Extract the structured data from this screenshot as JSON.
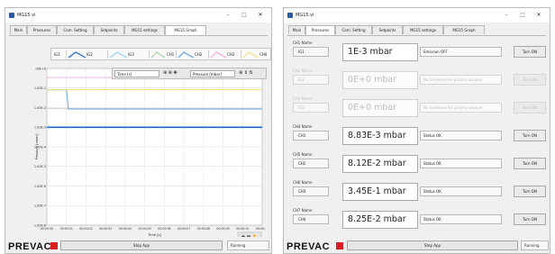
{
  "left_window": {
    "title": "MG15.vi",
    "controls": {
      "minimize": "–",
      "maximize": "□",
      "close": "✕"
    },
    "tabs": [
      {
        "label": "Main",
        "active": false
      },
      {
        "label": "Pressures",
        "active": false
      },
      {
        "label": "Com. Setting",
        "active": false
      },
      {
        "label": "Setpoints",
        "active": false
      },
      {
        "label": "MG15 settings",
        "active": false
      },
      {
        "label": "MG15 Graph",
        "active": true
      }
    ],
    "legend": [
      {
        "label": "IG1",
        "color": "#1e63c8"
      },
      {
        "label": "IG2",
        "color": "#e8e8e8"
      },
      {
        "label": "IG3",
        "color": "#8fd1f0"
      },
      {
        "label": "CH1",
        "color": "#c8c8c8"
      },
      {
        "label": "CH2",
        "color": "#5aa0e0"
      },
      {
        "label": "CH3",
        "color": "#f3a6e0"
      },
      {
        "label": "CH4",
        "color": "#f2e07a"
      }
    ],
    "cursor_panel": {
      "x_field": "Time [s]",
      "x_icons": "⊕ ⊛ ✥",
      "y_field": "Pressure [mbar]",
      "y_icons": "⊕ ⇕ ⇅"
    },
    "graph": {
      "y_axis_title": "Pressure [mbar]",
      "x_axis_title": "Time [s]",
      "tool_icons": "✚ ▦ ✋"
    },
    "footer": {
      "logo": "PREVAC",
      "stop_label": "Stop App",
      "state_label": "Running"
    }
  },
  "right_window": {
    "title": "MG15.vi",
    "controls": {
      "minimize": "–",
      "maximize": "□",
      "close": "✕"
    },
    "tabs": [
      {
        "label": "Main",
        "active": false
      },
      {
        "label": "Pressures",
        "active": true
      },
      {
        "label": "Com. Setting",
        "active": false
      },
      {
        "label": "Setpoints",
        "active": false
      },
      {
        "label": "MG15 settings",
        "active": false
      },
      {
        "label": "MG15 Graph",
        "active": false
      }
    ],
    "channels": [
      {
        "name_label": "CH1 Name",
        "name": "IG1",
        "pressure": "1E-3 mbar",
        "status": "Emission OFF",
        "button": "Turn ON",
        "enabled": true
      },
      {
        "name_label": "CH2 Name",
        "name": "IG2",
        "pressure": "0E+0 mbar",
        "status": "No hardware for plasma vacuum",
        "button": "Turn ON",
        "enabled": false
      },
      {
        "name_label": "CH3 Name",
        "name": "IG3",
        "pressure": "0E+0 mbar",
        "status": "No hardware for plasma vacuum",
        "button": "Turn ON",
        "enabled": false
      },
      {
        "name_label": "CH4 Name",
        "name": "CH1",
        "pressure": "8.83E-3 mbar",
        "status": "Status OK",
        "button": "Turn ON",
        "enabled": true
      },
      {
        "name_label": "CH5 Name",
        "name": "CH2",
        "pressure": "8.12E-2 mbar",
        "status": "Status OK",
        "button": "Turn ON",
        "enabled": true
      },
      {
        "name_label": "CH6 Name",
        "name": "CH3",
        "pressure": "3.45E-1 mbar",
        "status": "Status OK",
        "button": "Turn ON",
        "enabled": true
      },
      {
        "name_label": "CH7 Name",
        "name": "CH4",
        "pressure": "8.25E-2 mbar",
        "status": "Status OK",
        "button": "Turn ON",
        "enabled": true
      }
    ],
    "footer": {
      "logo": "PREVAC",
      "stop_label": "Stop App",
      "state_label": "Running"
    }
  },
  "chart_data": {
    "type": "line",
    "title": "",
    "xlabel": "Time [s]",
    "ylabel": "Pressure [mbar]",
    "y_scale": "log",
    "ylim": [
      1e-08,
      1
    ],
    "y_ticks": [
      "1.00E-8",
      "1.00E-7",
      "1.00E-6",
      "1.00E-5",
      "1.00E-4",
      "1.00E-3",
      "1.00E-2",
      "1.00E-1",
      "1.00E+0"
    ],
    "x_ticks": [
      "00:00:00",
      "00:00:01",
      "00:00:02",
      "00:00:03",
      "00:00:04",
      "00:00:05",
      "00:00:06",
      "00:00:07",
      "00:00:08",
      "00:00:09",
      "00:00:10",
      "00:00:11"
    ],
    "xlim": [
      0,
      11
    ],
    "grid": true,
    "series": [
      {
        "name": "IG1",
        "color": "#1e63c8",
        "x": [
          0,
          11
        ],
        "y": [
          0.001,
          0.001
        ]
      },
      {
        "name": "CH1",
        "color": "#c8c8c8",
        "x": [
          0,
          11
        ],
        "y": [
          0.00883,
          0.00883
        ]
      },
      {
        "name": "CH2",
        "color": "#5aa0e0",
        "x": [
          0,
          1,
          1.1,
          11
        ],
        "y": [
          0.0812,
          0.0812,
          0.0085,
          0.0085
        ]
      },
      {
        "name": "CH3",
        "color": "#f3a6e0",
        "x": [
          0,
          11
        ],
        "y": [
          0.345,
          0.345
        ]
      },
      {
        "name": "CH4",
        "color": "#f2e07a",
        "x": [
          0,
          11
        ],
        "y": [
          0.0825,
          0.0825
        ]
      }
    ]
  }
}
